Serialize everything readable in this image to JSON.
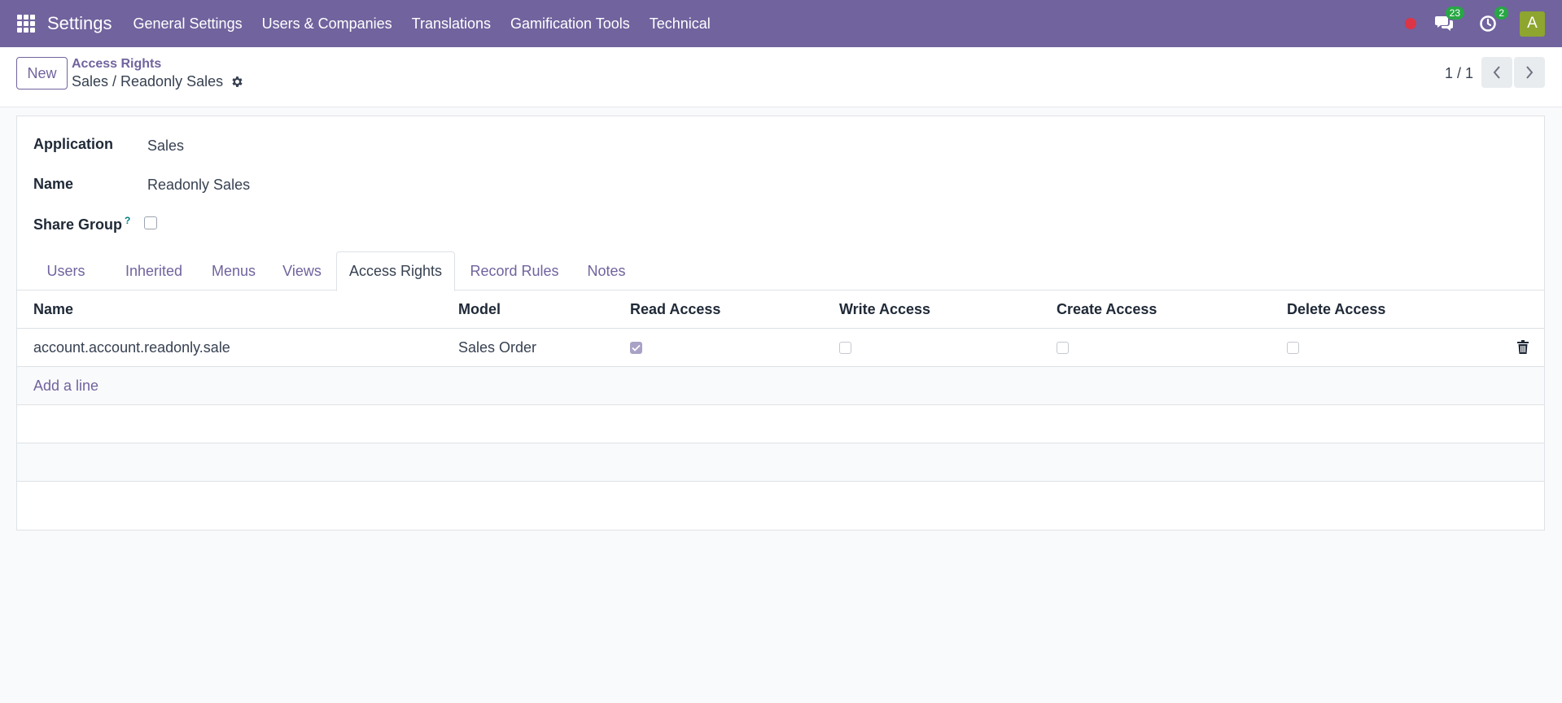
{
  "navbar": {
    "brand": "Settings",
    "menu": [
      "General Settings",
      "Users & Companies",
      "Translations",
      "Gamification Tools",
      "Technical"
    ],
    "messages_count": "23",
    "activities_count": "2",
    "avatar_initial": "A",
    "color": "#71639e"
  },
  "control": {
    "new_label": "New",
    "breadcrumb_parent": "Access Rights",
    "breadcrumb_current": "Sales / Readonly Sales",
    "pager": "1 / 1"
  },
  "form": {
    "application_label": "Application",
    "application_value": "Sales",
    "name_label": "Name",
    "name_value": "Readonly Sales",
    "share_group_label": "Share Group",
    "share_group_help": "?",
    "share_group_checked": false
  },
  "tabs": [
    "Users",
    "Inherited",
    "Menus",
    "Views",
    "Access Rights",
    "Record Rules",
    "Notes"
  ],
  "active_tab": "Access Rights",
  "table": {
    "headers": [
      "Name",
      "Model",
      "Read Access",
      "Write Access",
      "Create Access",
      "Delete Access"
    ],
    "rows": [
      {
        "name": "account.account.readonly.sale",
        "model": "Sales Order",
        "read": true,
        "write": false,
        "create": false,
        "delete": false
      }
    ],
    "add_line": "Add a line"
  }
}
